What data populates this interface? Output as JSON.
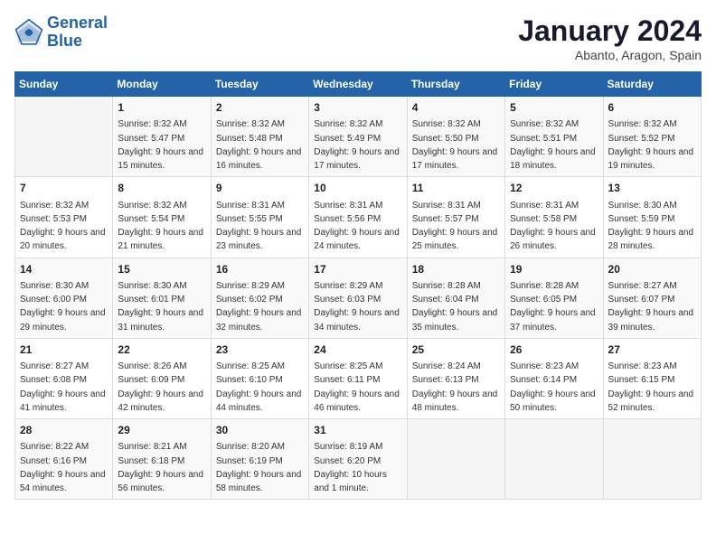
{
  "header": {
    "logo_line1": "General",
    "logo_line2": "Blue",
    "month": "January 2024",
    "location": "Abanto, Aragon, Spain"
  },
  "days_of_week": [
    "Sunday",
    "Monday",
    "Tuesday",
    "Wednesday",
    "Thursday",
    "Friday",
    "Saturday"
  ],
  "weeks": [
    [
      {
        "day": "",
        "sunrise": "",
        "sunset": "",
        "daylight": ""
      },
      {
        "day": "1",
        "sunrise": "Sunrise: 8:32 AM",
        "sunset": "Sunset: 5:47 PM",
        "daylight": "Daylight: 9 hours and 15 minutes."
      },
      {
        "day": "2",
        "sunrise": "Sunrise: 8:32 AM",
        "sunset": "Sunset: 5:48 PM",
        "daylight": "Daylight: 9 hours and 16 minutes."
      },
      {
        "day": "3",
        "sunrise": "Sunrise: 8:32 AM",
        "sunset": "Sunset: 5:49 PM",
        "daylight": "Daylight: 9 hours and 17 minutes."
      },
      {
        "day": "4",
        "sunrise": "Sunrise: 8:32 AM",
        "sunset": "Sunset: 5:50 PM",
        "daylight": "Daylight: 9 hours and 17 minutes."
      },
      {
        "day": "5",
        "sunrise": "Sunrise: 8:32 AM",
        "sunset": "Sunset: 5:51 PM",
        "daylight": "Daylight: 9 hours and 18 minutes."
      },
      {
        "day": "6",
        "sunrise": "Sunrise: 8:32 AM",
        "sunset": "Sunset: 5:52 PM",
        "daylight": "Daylight: 9 hours and 19 minutes."
      }
    ],
    [
      {
        "day": "7",
        "sunrise": "Sunrise: 8:32 AM",
        "sunset": "Sunset: 5:53 PM",
        "daylight": "Daylight: 9 hours and 20 minutes."
      },
      {
        "day": "8",
        "sunrise": "Sunrise: 8:32 AM",
        "sunset": "Sunset: 5:54 PM",
        "daylight": "Daylight: 9 hours and 21 minutes."
      },
      {
        "day": "9",
        "sunrise": "Sunrise: 8:31 AM",
        "sunset": "Sunset: 5:55 PM",
        "daylight": "Daylight: 9 hours and 23 minutes."
      },
      {
        "day": "10",
        "sunrise": "Sunrise: 8:31 AM",
        "sunset": "Sunset: 5:56 PM",
        "daylight": "Daylight: 9 hours and 24 minutes."
      },
      {
        "day": "11",
        "sunrise": "Sunrise: 8:31 AM",
        "sunset": "Sunset: 5:57 PM",
        "daylight": "Daylight: 9 hours and 25 minutes."
      },
      {
        "day": "12",
        "sunrise": "Sunrise: 8:31 AM",
        "sunset": "Sunset: 5:58 PM",
        "daylight": "Daylight: 9 hours and 26 minutes."
      },
      {
        "day": "13",
        "sunrise": "Sunrise: 8:30 AM",
        "sunset": "Sunset: 5:59 PM",
        "daylight": "Daylight: 9 hours and 28 minutes."
      }
    ],
    [
      {
        "day": "14",
        "sunrise": "Sunrise: 8:30 AM",
        "sunset": "Sunset: 6:00 PM",
        "daylight": "Daylight: 9 hours and 29 minutes."
      },
      {
        "day": "15",
        "sunrise": "Sunrise: 8:30 AM",
        "sunset": "Sunset: 6:01 PM",
        "daylight": "Daylight: 9 hours and 31 minutes."
      },
      {
        "day": "16",
        "sunrise": "Sunrise: 8:29 AM",
        "sunset": "Sunset: 6:02 PM",
        "daylight": "Daylight: 9 hours and 32 minutes."
      },
      {
        "day": "17",
        "sunrise": "Sunrise: 8:29 AM",
        "sunset": "Sunset: 6:03 PM",
        "daylight": "Daylight: 9 hours and 34 minutes."
      },
      {
        "day": "18",
        "sunrise": "Sunrise: 8:28 AM",
        "sunset": "Sunset: 6:04 PM",
        "daylight": "Daylight: 9 hours and 35 minutes."
      },
      {
        "day": "19",
        "sunrise": "Sunrise: 8:28 AM",
        "sunset": "Sunset: 6:05 PM",
        "daylight": "Daylight: 9 hours and 37 minutes."
      },
      {
        "day": "20",
        "sunrise": "Sunrise: 8:27 AM",
        "sunset": "Sunset: 6:07 PM",
        "daylight": "Daylight: 9 hours and 39 minutes."
      }
    ],
    [
      {
        "day": "21",
        "sunrise": "Sunrise: 8:27 AM",
        "sunset": "Sunset: 6:08 PM",
        "daylight": "Daylight: 9 hours and 41 minutes."
      },
      {
        "day": "22",
        "sunrise": "Sunrise: 8:26 AM",
        "sunset": "Sunset: 6:09 PM",
        "daylight": "Daylight: 9 hours and 42 minutes."
      },
      {
        "day": "23",
        "sunrise": "Sunrise: 8:25 AM",
        "sunset": "Sunset: 6:10 PM",
        "daylight": "Daylight: 9 hours and 44 minutes."
      },
      {
        "day": "24",
        "sunrise": "Sunrise: 8:25 AM",
        "sunset": "Sunset: 6:11 PM",
        "daylight": "Daylight: 9 hours and 46 minutes."
      },
      {
        "day": "25",
        "sunrise": "Sunrise: 8:24 AM",
        "sunset": "Sunset: 6:13 PM",
        "daylight": "Daylight: 9 hours and 48 minutes."
      },
      {
        "day": "26",
        "sunrise": "Sunrise: 8:23 AM",
        "sunset": "Sunset: 6:14 PM",
        "daylight": "Daylight: 9 hours and 50 minutes."
      },
      {
        "day": "27",
        "sunrise": "Sunrise: 8:23 AM",
        "sunset": "Sunset: 6:15 PM",
        "daylight": "Daylight: 9 hours and 52 minutes."
      }
    ],
    [
      {
        "day": "28",
        "sunrise": "Sunrise: 8:22 AM",
        "sunset": "Sunset: 6:16 PM",
        "daylight": "Daylight: 9 hours and 54 minutes."
      },
      {
        "day": "29",
        "sunrise": "Sunrise: 8:21 AM",
        "sunset": "Sunset: 6:18 PM",
        "daylight": "Daylight: 9 hours and 56 minutes."
      },
      {
        "day": "30",
        "sunrise": "Sunrise: 8:20 AM",
        "sunset": "Sunset: 6:19 PM",
        "daylight": "Daylight: 9 hours and 58 minutes."
      },
      {
        "day": "31",
        "sunrise": "Sunrise: 8:19 AM",
        "sunset": "Sunset: 6:20 PM",
        "daylight": "Daylight: 10 hours and 1 minute."
      },
      {
        "day": "",
        "sunrise": "",
        "sunset": "",
        "daylight": ""
      },
      {
        "day": "",
        "sunrise": "",
        "sunset": "",
        "daylight": ""
      },
      {
        "day": "",
        "sunrise": "",
        "sunset": "",
        "daylight": ""
      }
    ]
  ]
}
